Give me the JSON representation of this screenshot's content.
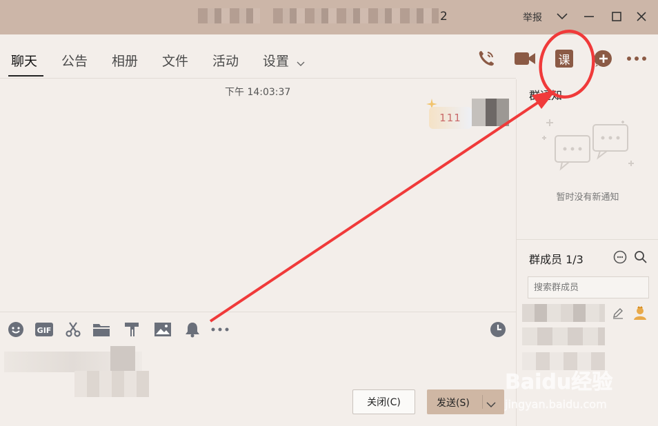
{
  "window": {
    "title_suffix": "2",
    "report_label": "举报"
  },
  "tabs": [
    {
      "label": "聊天"
    },
    {
      "label": "公告"
    },
    {
      "label": "相册"
    },
    {
      "label": "文件"
    },
    {
      "label": "活动"
    },
    {
      "label": "设置"
    }
  ],
  "header_icons": {
    "course_label": "课"
  },
  "chat": {
    "timestamp": "下午 14:03:37",
    "message": "111"
  },
  "buttons": {
    "close": "关闭(C)",
    "send": "发送(S)"
  },
  "right_panel": {
    "notice_title": "群通知",
    "notice_empty": "暂时没有新通知",
    "members_title": "群成员 1/3",
    "search_placeholder": "搜索群成员"
  },
  "watermark": {
    "brand": "Baidu经验",
    "url": "jingyan.baidu.com"
  },
  "colors": {
    "titlebar": "#ccb6a8",
    "background": "#f3eeea",
    "accent_icon": "#8b5a45",
    "annotation": "#f03a3a"
  }
}
